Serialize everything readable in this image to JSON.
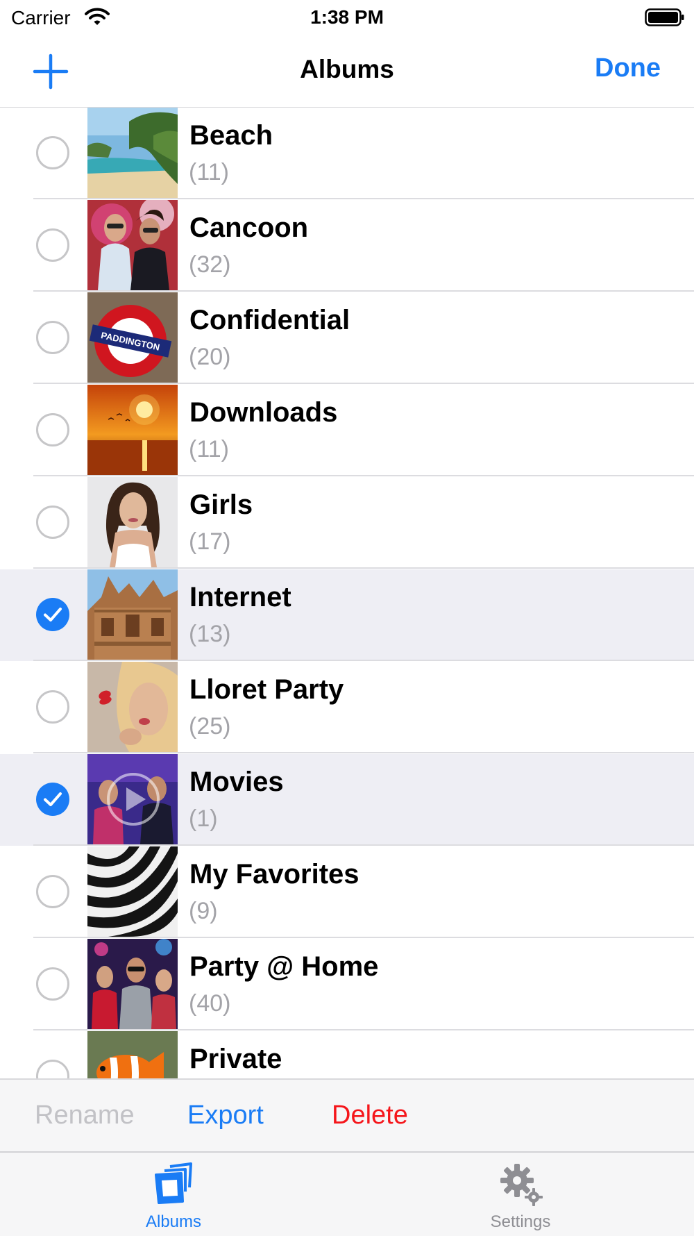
{
  "status_bar": {
    "carrier": "Carrier",
    "time": "1:38 PM"
  },
  "nav": {
    "title": "Albums",
    "done_label": "Done",
    "add_icon": "plus-icon"
  },
  "albums": [
    {
      "name": "Beach",
      "count": "(11)",
      "selected": false,
      "thumb": "beach"
    },
    {
      "name": "Cancoon",
      "count": "(32)",
      "selected": false,
      "thumb": "party"
    },
    {
      "name": "Confidential",
      "count": "(20)",
      "selected": false,
      "thumb": "sign"
    },
    {
      "name": "Downloads",
      "count": "(11)",
      "selected": false,
      "thumb": "sunset"
    },
    {
      "name": "Girls",
      "count": "(17)",
      "selected": false,
      "thumb": "portrait"
    },
    {
      "name": "Internet",
      "count": "(13)",
      "selected": true,
      "thumb": "temple"
    },
    {
      "name": "Lloret Party",
      "count": "(25)",
      "selected": false,
      "thumb": "kiss"
    },
    {
      "name": "Movies",
      "count": "(1)",
      "selected": true,
      "thumb": "movie"
    },
    {
      "name": "My Favorites",
      "count": "(9)",
      "selected": false,
      "thumb": "zebra"
    },
    {
      "name": "Party @ Home",
      "count": "(40)",
      "selected": false,
      "thumb": "club"
    },
    {
      "name": "Private",
      "count": "",
      "selected": false,
      "thumb": "fish"
    }
  ],
  "paddington_text": "PADDINGTON",
  "actions": {
    "rename": "Rename",
    "export": "Export",
    "delete": "Delete"
  },
  "tabs": [
    {
      "label": "Albums",
      "icon": "photo-stack-icon",
      "active": true
    },
    {
      "label": "Settings",
      "icon": "gear-icon",
      "active": false
    }
  ],
  "colors": {
    "accent": "#1a7cf5",
    "destructive": "#f5161b",
    "disabled": "#c2c2c6",
    "selected_row": "#eeeef4"
  }
}
